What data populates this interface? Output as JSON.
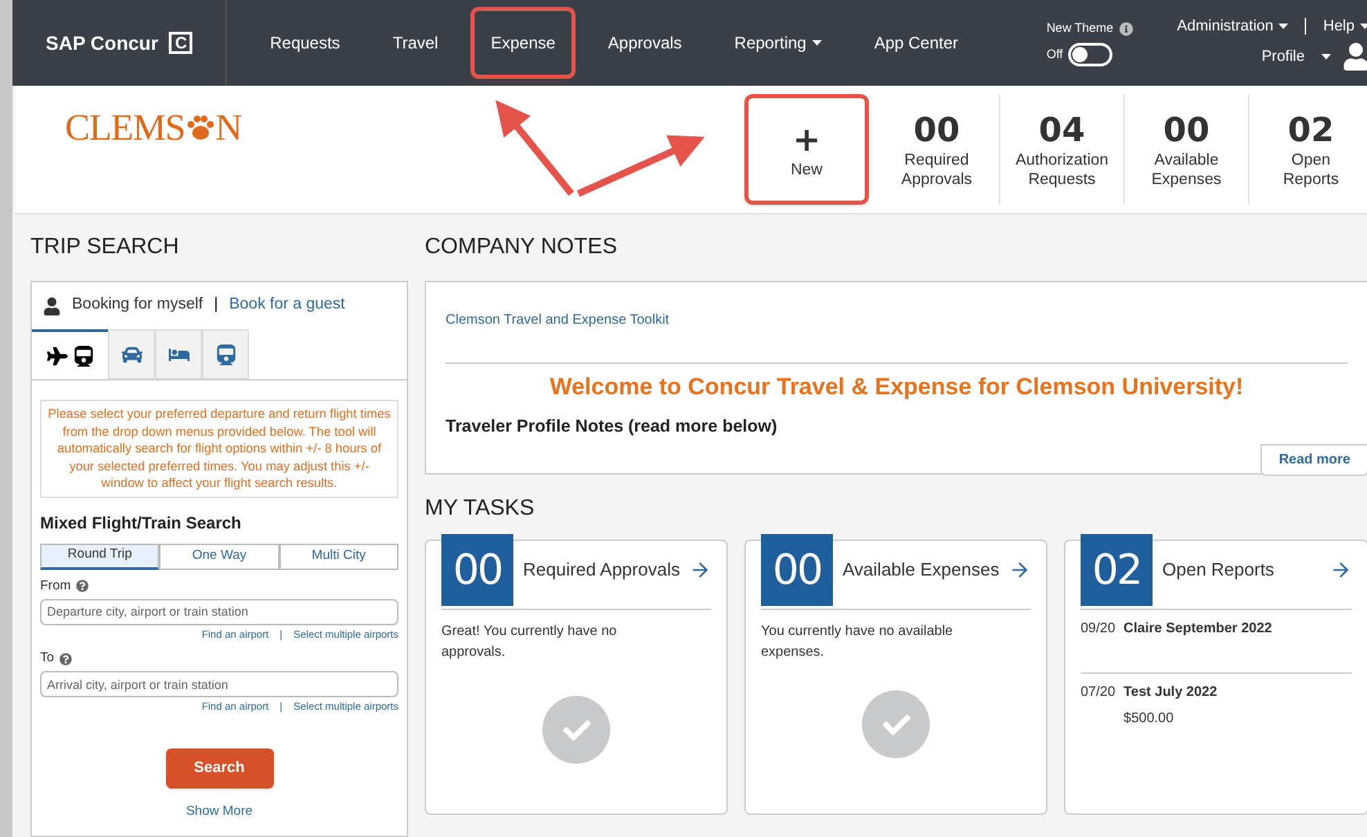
{
  "navbar": {
    "brand": "SAP Concur",
    "brand_mark": "C",
    "items": [
      {
        "label": "Requests",
        "dropdown": false,
        "highlighted": false
      },
      {
        "label": "Travel",
        "dropdown": false,
        "highlighted": false
      },
      {
        "label": "Expense",
        "dropdown": false,
        "highlighted": true
      },
      {
        "label": "Approvals",
        "dropdown": false,
        "highlighted": false
      },
      {
        "label": "Reporting",
        "dropdown": true,
        "highlighted": false
      },
      {
        "label": "App Center",
        "dropdown": false,
        "highlighted": false
      }
    ],
    "new_theme": {
      "label": "New Theme",
      "toggle_label": "Off",
      "on": false
    },
    "administration": "Administration",
    "help": "Help",
    "profile": "Profile"
  },
  "header": {
    "logo_left": "CLEMS",
    "logo_right": "N",
    "tiles": [
      {
        "kind": "new",
        "symbol": "+",
        "label": "New",
        "highlighted": true
      },
      {
        "kind": "count",
        "count": "00",
        "label": "Required Approvals",
        "highlighted": false
      },
      {
        "kind": "count",
        "count": "04",
        "label": "Authorization Requests",
        "highlighted": false
      },
      {
        "kind": "count",
        "count": "00",
        "label": "Available Expenses",
        "highlighted": false
      },
      {
        "kind": "count",
        "count": "02",
        "label": "Open Reports",
        "highlighted": false
      }
    ]
  },
  "trip_search": {
    "title": "TRIP SEARCH",
    "booking_self": "Booking for myself",
    "separator": "|",
    "booking_guest": "Book for a guest",
    "tabs": [
      {
        "kind": "flight-train",
        "selected": true
      },
      {
        "kind": "car",
        "selected": false
      },
      {
        "kind": "hotel",
        "selected": false
      },
      {
        "kind": "train",
        "selected": false
      }
    ],
    "notice": "Please select your preferred departure and return flight times from the drop down menus provided below. The tool will automatically search for flight options within +/- 8 hours of your selected preferred times. You may adjust this +/- window to affect your flight search results.",
    "section_title": "Mixed Flight/Train Search",
    "trip_types": [
      {
        "label": "Round Trip",
        "selected": true
      },
      {
        "label": "One Way",
        "selected": false
      },
      {
        "label": "Multi City",
        "selected": false
      }
    ],
    "fields": [
      {
        "label": "From",
        "placeholder": "Departure city, airport or train station",
        "links": [
          "Find an airport",
          "|",
          "Select multiple airports"
        ]
      },
      {
        "label": "To",
        "placeholder": "Arrival city, airport or train station",
        "links": [
          "Find an airport",
          "|",
          "Select multiple airports"
        ]
      }
    ],
    "search_button": "Search",
    "show_more": "Show More"
  },
  "company_notes": {
    "title": "COMPANY NOTES",
    "link": "Clemson Travel and Expense Toolkit",
    "welcome": "Welcome to Concur Travel & Expense for Clemson University!",
    "subtitle": "Traveler Profile Notes (read more below)",
    "read_more": "Read more"
  },
  "my_tasks": {
    "title": "MY TASKS",
    "cards": [
      {
        "kind": "empty",
        "count": "00",
        "title": "Required Approvals",
        "message": "Great! You currently have no approvals."
      },
      {
        "kind": "empty",
        "count": "00",
        "title": "Available Expenses",
        "message": "You currently have no available expenses."
      },
      {
        "kind": "list",
        "count": "02",
        "title": "Open Reports",
        "reports": [
          {
            "date": "09/20",
            "name": "Claire September 2022"
          },
          {
            "date": "07/20",
            "name": "Test July 2022",
            "amount": "$500.00"
          }
        ]
      }
    ]
  }
}
